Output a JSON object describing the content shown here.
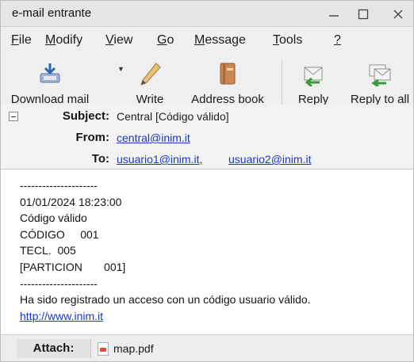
{
  "window": {
    "title": "e-mail entrante",
    "controls": {
      "minimize_icon": "minimize-icon",
      "maximize_icon": "maximize-icon",
      "close_icon": "close-icon"
    }
  },
  "menu": [
    {
      "label": "File",
      "underline": "F",
      "rest": "ile"
    },
    {
      "label": "Modify",
      "underline": "M",
      "rest": "odify"
    },
    {
      "label": "View",
      "underline": "V",
      "rest": "iew"
    },
    {
      "label": "Go",
      "underline": "G",
      "rest": "o"
    },
    {
      "label": "Message",
      "underline": "M",
      "rest": "essage"
    },
    {
      "label": "Tools",
      "underline": "T",
      "rest": "ools"
    },
    {
      "label": "?",
      "underline": "?",
      "rest": ""
    }
  ],
  "toolbar": {
    "download_mail": {
      "label": "Download mail",
      "icon": "download-mail-icon"
    },
    "write": {
      "label": "Write",
      "icon": "pencil-icon"
    },
    "address_book": {
      "label": "Address book",
      "icon": "address-book-icon"
    },
    "reply": {
      "label": "Reply",
      "icon": "reply-icon"
    },
    "reply_all": {
      "label": "Reply to all",
      "icon": "reply-all-icon"
    }
  },
  "headers": {
    "subject_label": "Subject:",
    "subject_value": "Central [Código válido]",
    "from_label": "From:",
    "from_value": "central@inim.it",
    "to_label": "To:",
    "to_values": [
      "usuario1@inim.it,",
      "usuario2@inim.it"
    ]
  },
  "body": {
    "lines": [
      "---------------------",
      "01/01/2024 18:23:00",
      "Código válido",
      "CÓDIGO     001",
      "TECL.  005",
      "[PARTICION       001]",
      "---------------------",
      "Ha sido registrado un acceso con un código usuario válido."
    ],
    "link": "http://www.inim.it"
  },
  "attachments": {
    "label": "Attach:",
    "items": [
      {
        "name": "map.pdf",
        "icon": "pdf-file-icon"
      }
    ]
  },
  "colors": {
    "link": "#1a37c4",
    "titlebar": "#e6e6e6",
    "toolbar": "#efefef"
  }
}
